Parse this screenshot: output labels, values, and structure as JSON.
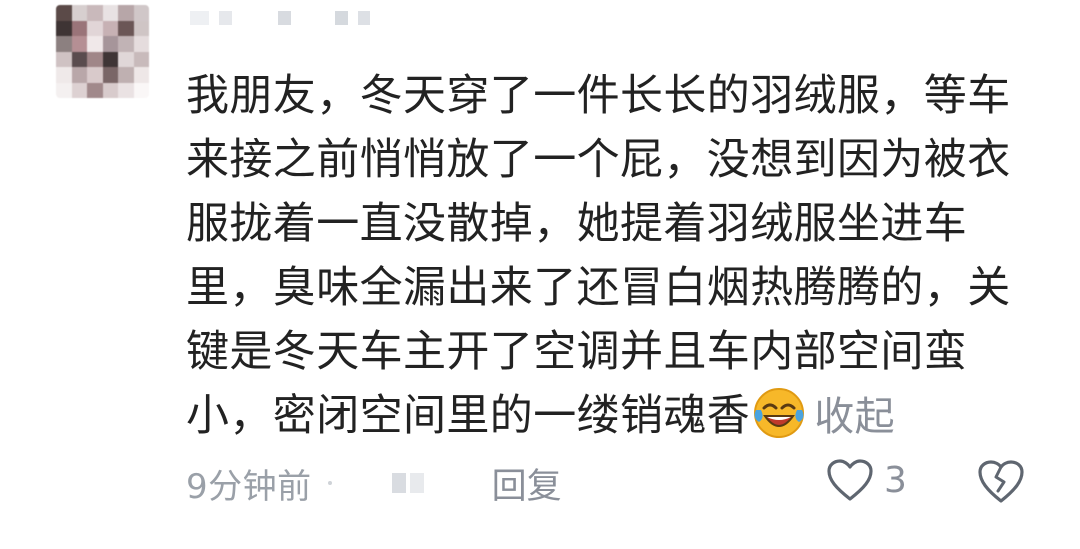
{
  "comment": {
    "text": "我朋友，冬天穿了一件长长的羽绒服，等车来接之前悄悄放了一个屁，没想到因为被衣服拢着一直没散掉，她提着羽绒服坐进车里，臭味全漏出来了还冒白烟热腾腾的，关键是冬天车主开了空调并且车内部空间蛮小，密闭空间里的一缕销魂香",
    "emoji": "laughing-crying-emoji",
    "collapse_label": "收起"
  },
  "footer": {
    "time": "9分钟前",
    "reply_label": "回复",
    "like_count": "3"
  },
  "icons": {
    "like": "heart-outline-icon",
    "dislike": "broken-heart-icon"
  },
  "colors": {
    "text": "#222222",
    "muted": "#8a8f99",
    "emoji_yellow": "#f7b829",
    "emoji_mouth": "#c0392b",
    "tears": "#4aa3df"
  }
}
